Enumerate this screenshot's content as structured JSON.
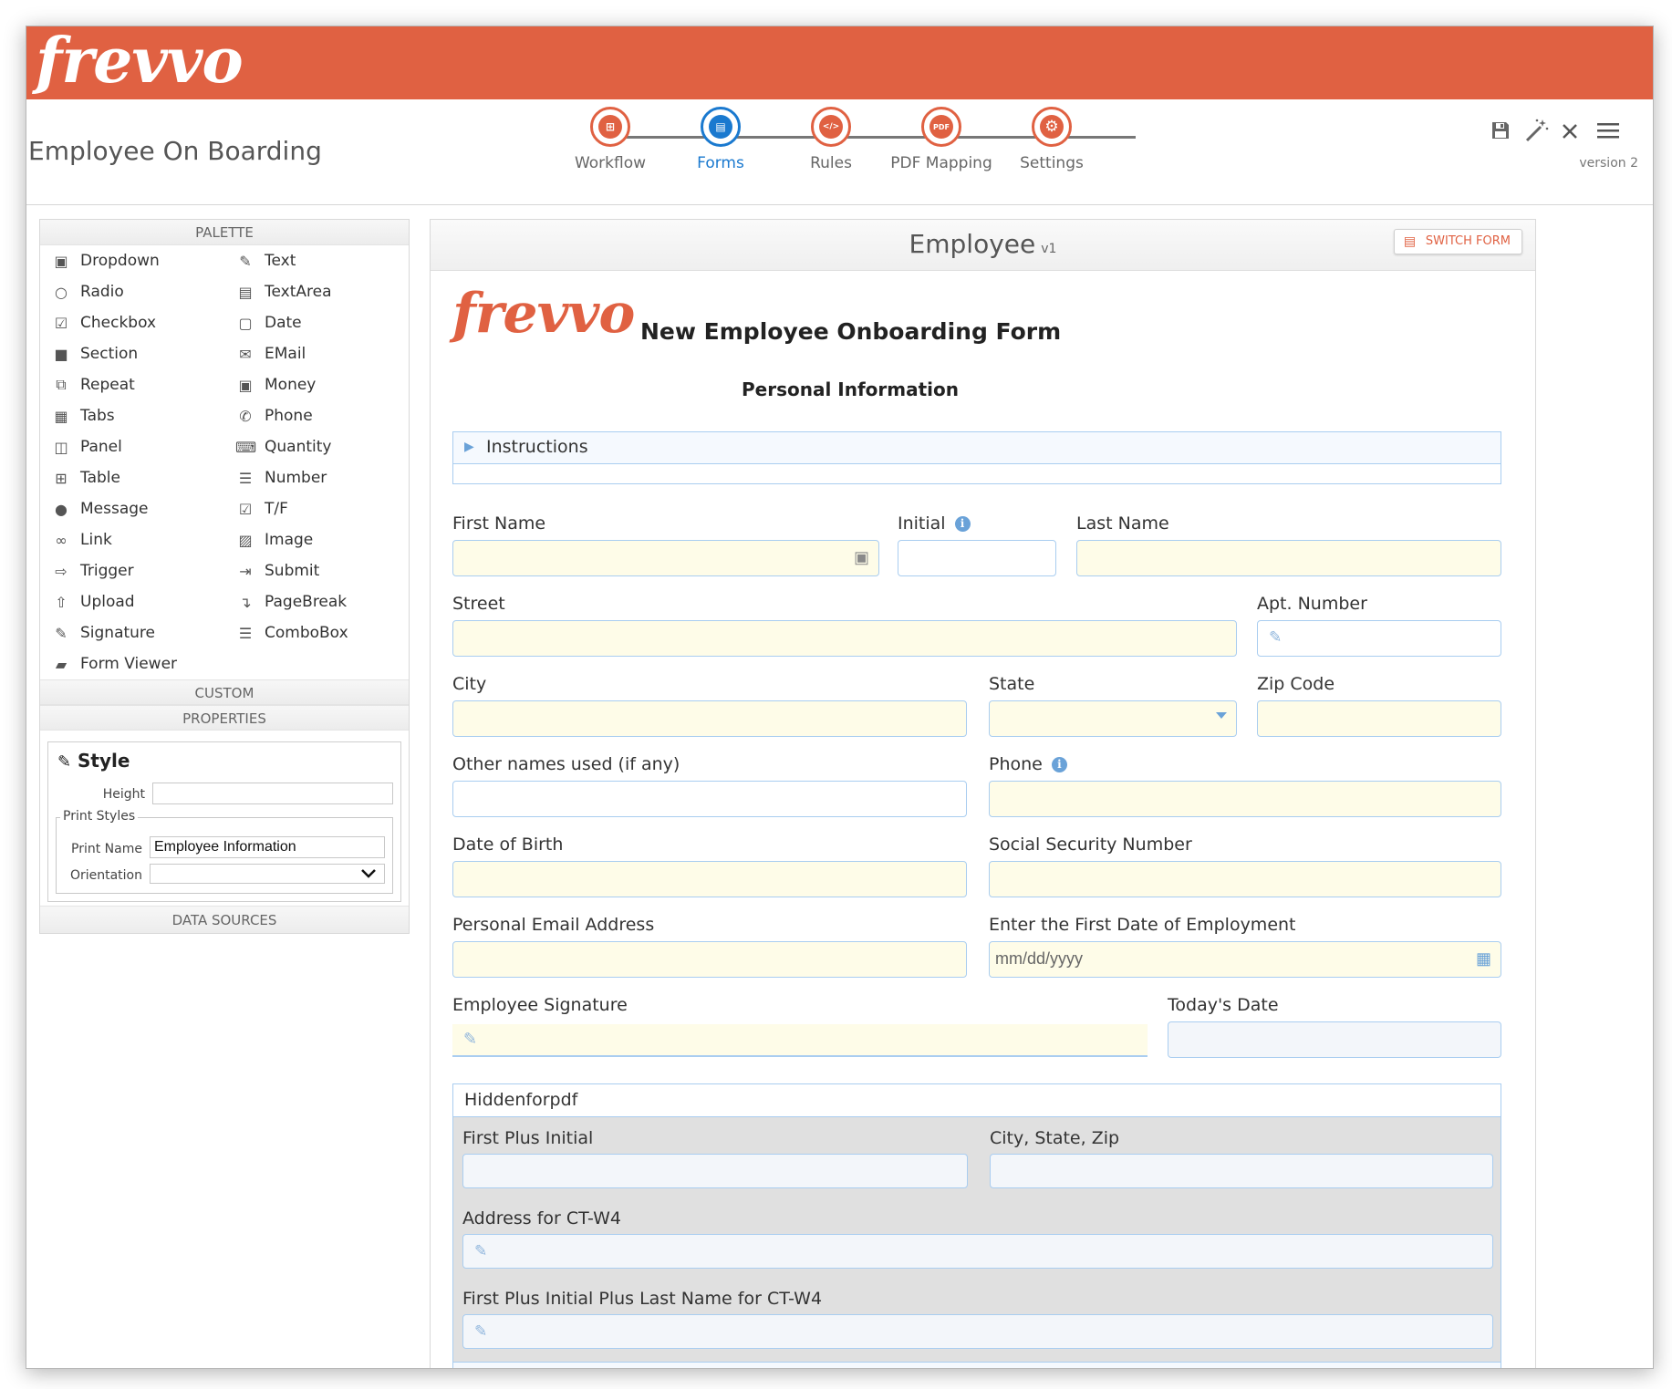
{
  "brand": {
    "logo_text": "frevvo",
    "color": "#e06142"
  },
  "header": {
    "title": "Employee On Boarding",
    "steps": [
      {
        "label": "Workflow",
        "icon": "workflow-icon",
        "glyph": "⊞"
      },
      {
        "label": "Forms",
        "icon": "forms-icon",
        "glyph": "▤",
        "active": true
      },
      {
        "label": "Rules",
        "icon": "rules-icon",
        "glyph": "</>"
      },
      {
        "label": "PDF Mapping",
        "icon": "pdf-icon",
        "glyph": "PDF"
      },
      {
        "label": "Settings",
        "icon": "gear-icon",
        "glyph": "⚙"
      }
    ],
    "version": "version 2"
  },
  "palette": {
    "title": "PALETTE",
    "left": [
      "Dropdown",
      "Radio",
      "Checkbox",
      "Section",
      "Repeat",
      "Tabs",
      "Panel",
      "Table",
      "Message",
      "Link",
      "Trigger",
      "Upload",
      "Signature",
      "Form Viewer"
    ],
    "right": [
      "Text",
      "TextArea",
      "Date",
      "EMail",
      "Money",
      "Phone",
      "Quantity",
      "Number",
      "T/F",
      "Image",
      "Submit",
      "PageBreak",
      "ComboBox"
    ],
    "custom_title": "CUSTOM",
    "properties_title": "PROPERTIES"
  },
  "style": {
    "title": "Style",
    "height_label": "Height",
    "height_value": "",
    "print_styles_label": "Print Styles",
    "print_name_label": "Print Name",
    "print_name_value": "Employee Information",
    "orientation_label": "Orientation",
    "orientation_value": ""
  },
  "data_sources_title": "DATA SOURCES",
  "form": {
    "name": "Employee",
    "version": "v1",
    "switch_label": "SWITCH FORM",
    "logo_text": "frevvo",
    "title": "New Employee Onboarding Form",
    "subtitle": "Personal Information",
    "instructions_label": "Instructions",
    "fields": {
      "first_name": "First Name",
      "initial": "Initial",
      "last_name": "Last Name",
      "street": "Street",
      "apt": "Apt. Number",
      "city": "City",
      "state": "State",
      "zip": "Zip Code",
      "other_names": "Other names used (if any)",
      "phone": "Phone",
      "dob": "Date of Birth",
      "ssn": "Social Security Number",
      "email": "Personal Email Address",
      "first_date": "Enter the First Date of Employment",
      "first_date_placeholder": "mm/dd/yyyy",
      "signature": "Employee Signature",
      "todays_date": "Today's Date"
    },
    "hidden": {
      "title": "Hiddenforpdf",
      "first_plus_initial": "First Plus Initial",
      "city_state_zip": "City, State, Zip",
      "address_ctw4": "Address for CT-W4",
      "full_name_ctw4": "First Plus Initial Plus Last Name for CT-W4"
    }
  }
}
